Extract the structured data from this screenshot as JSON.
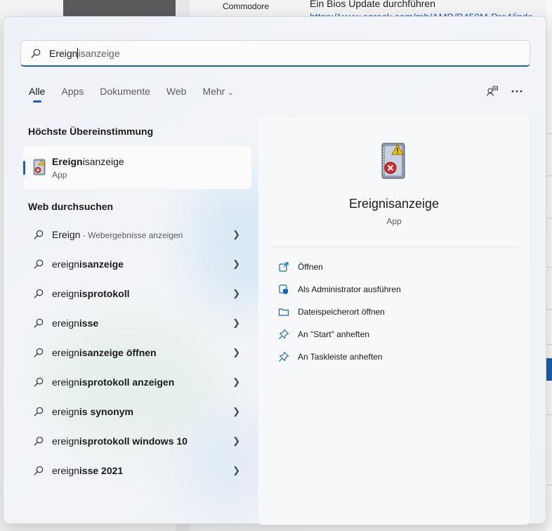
{
  "background": {
    "commodore": "Commodore",
    "heading": "Ein Bios Update durchführen",
    "link": "https://www.asrock.com/mb/AMD/B450M-Pro4/inde"
  },
  "search": {
    "typed": "Ereign",
    "completion": "isanzeige",
    "placeholder": "Ereignisanzeige"
  },
  "tabs": [
    {
      "label": "Alle",
      "active": true
    },
    {
      "label": "Apps"
    },
    {
      "label": "Dokumente"
    },
    {
      "label": "Web"
    },
    {
      "label": "Mehr"
    }
  ],
  "best_match": {
    "title": "Höchste Übereinstimmung",
    "name_bold": "Ereign",
    "name_rest": "isanzeige",
    "type": "App",
    "icon": "event-viewer-icon"
  },
  "web": {
    "title": "Web durchsuchen",
    "first": {
      "query": "Ereign",
      "suffix": " - Webergebnisse anzeigen"
    },
    "items": [
      {
        "prefix": "ereign",
        "rest": "isanzeige"
      },
      {
        "prefix": "ereign",
        "rest": "isprotokoll"
      },
      {
        "prefix": "ereign",
        "rest": "isse"
      },
      {
        "prefix": "ereign",
        "rest": "isanzeige öffnen"
      },
      {
        "prefix": "ereign",
        "rest": "isprotokoll anzeigen"
      },
      {
        "prefix": "ereign",
        "rest": "is synonym"
      },
      {
        "prefix": "ereign",
        "rest": "isprotokoll windows 10"
      },
      {
        "prefix": "ereign",
        "rest": "isse 2021"
      }
    ]
  },
  "detail": {
    "name": "Ereignisanzeige",
    "type": "App",
    "actions": [
      {
        "label": "Öffnen",
        "icon": "open-icon"
      },
      {
        "label": "Als Administrator ausführen",
        "icon": "shield-icon"
      },
      {
        "label": "Dateispeicherort öffnen",
        "icon": "folder-icon"
      },
      {
        "label": "An \"Start\" anheften",
        "icon": "pin-icon"
      },
      {
        "label": "An Taskleiste anheften",
        "icon": "pin-icon"
      }
    ]
  },
  "colors": {
    "accent": "#1565c0",
    "text": "#1b1b1b",
    "muted": "#5c5c5c"
  }
}
